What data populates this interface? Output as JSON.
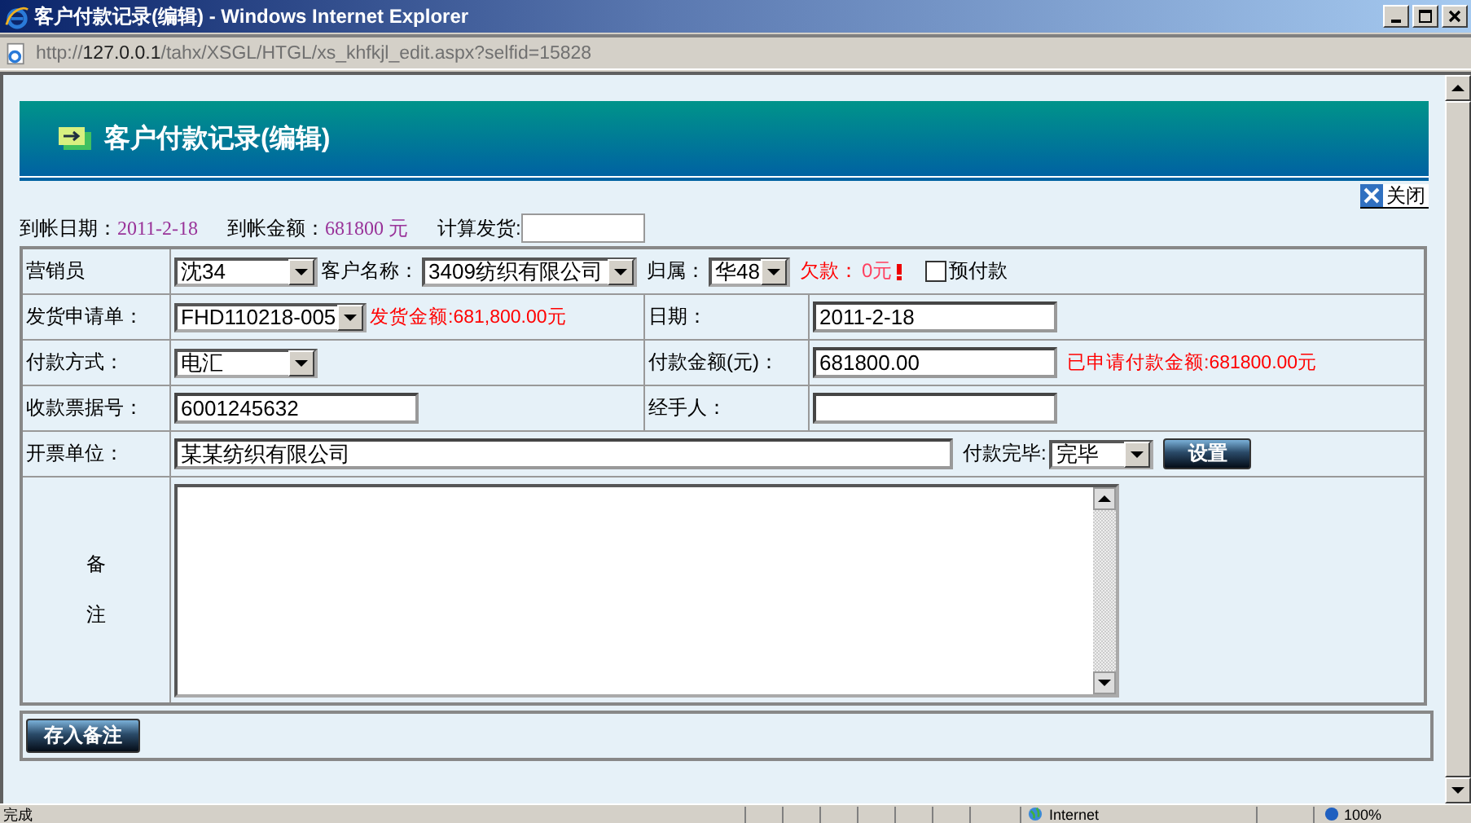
{
  "window": {
    "title": "客户付款记录(编辑) - Windows Internet Explorer"
  },
  "address_bar": {
    "scheme": "http://",
    "host": "127.0.0.1",
    "path": "/tahx/XSGL/HTGL/xs_khfkjl_edit.aspx?selfid=15828"
  },
  "page": {
    "heading": "客户付款记录(编辑)",
    "close_link": "关闭",
    "summary": [
      {
        "label": "到帐日期：",
        "value": "2011-2-18"
      },
      {
        "label": "到帐金额：",
        "value": "681800 元"
      }
    ],
    "calc_shipment": {
      "label": "计算发货:"
    },
    "form": {
      "salesperson": {
        "label": "营销员",
        "value": "沈34"
      },
      "customer": {
        "label": "客户名称：",
        "value": "3409纺织有限公司"
      },
      "belongs": {
        "label": "归属：",
        "value": "华48"
      },
      "debt": {
        "label": "欠款：",
        "value": "0元"
      },
      "prepaid": {
        "label": "预付款",
        "checked": false
      },
      "request": {
        "label": "发货申请单：",
        "value": "FHD110218-005",
        "note": "发货金额:681,800.00元"
      },
      "date": {
        "label": "日期：",
        "value": "2011-2-18"
      },
      "method": {
        "label": "付款方式：",
        "value": "电汇"
      },
      "amount": {
        "label": "付款金额(元)：",
        "value": "681800.00",
        "note": "已申请付款金额:681800.00元"
      },
      "receipt": {
        "label": "收款票据号：",
        "value": "6001245632"
      },
      "handler": {
        "label": "经手人："
      },
      "invoice": {
        "label": "开票单位：",
        "value": "某某纺织有限公司"
      },
      "finished": {
        "label": "付款完毕:",
        "value": "完毕",
        "button": "设置"
      },
      "notes": {
        "label": "备注"
      }
    },
    "save_button": "存入备注"
  },
  "status_bar": {
    "status": "完成",
    "zone": "Internet",
    "zoom": "100%"
  }
}
